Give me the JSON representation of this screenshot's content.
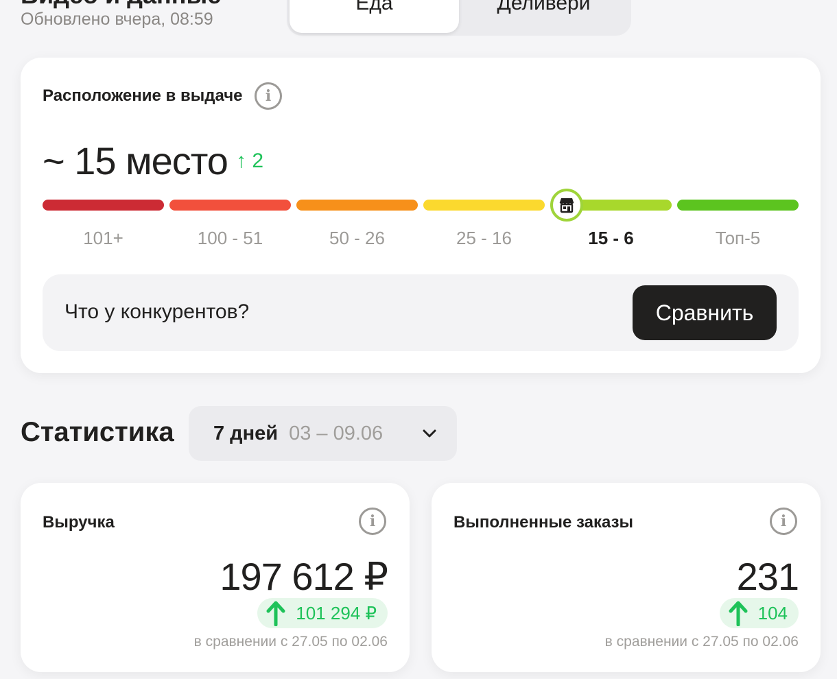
{
  "header": {
    "title": "Видео и данные",
    "updated": "Обновлено вчера, 08:59",
    "tabs": [
      {
        "label": "Еда",
        "active": true
      },
      {
        "label": "Деливери",
        "active": false
      }
    ]
  },
  "position": {
    "title": "Расположение в выдаче",
    "place": "~ 15 место",
    "delta": "↑ 2",
    "current_range_index": 4,
    "ranges": [
      {
        "label": "101+",
        "color": "#cc2b34"
      },
      {
        "label": "100 - 51",
        "color": "#f2503c"
      },
      {
        "label": "50 - 26",
        "color": "#f7901a"
      },
      {
        "label": "25 - 16",
        "color": "#fbd92e"
      },
      {
        "label": "15 - 6",
        "color": "#a8d82c"
      },
      {
        "label": "Топ-5",
        "color": "#5cc41f"
      }
    ],
    "marker_icon": "store-icon",
    "compare_text": "Что у конкурентов?",
    "compare_button": "Сравнить"
  },
  "stats": {
    "title": "Статистика",
    "period_days": "7 дней",
    "period_range": "03 – 09.06",
    "cards": [
      {
        "title": "Выручка",
        "value": "197 612 ₽",
        "delta": "101 294 ₽",
        "compare": "в сравнении с 27.05 по 02.06"
      },
      {
        "title": "Выполненные заказы",
        "value": "231",
        "delta": "104",
        "compare": "в сравнении с 27.05 по 02.06"
      }
    ]
  },
  "colors": {
    "accent_green": "#1ec259",
    "dark_button": "#21201f"
  }
}
